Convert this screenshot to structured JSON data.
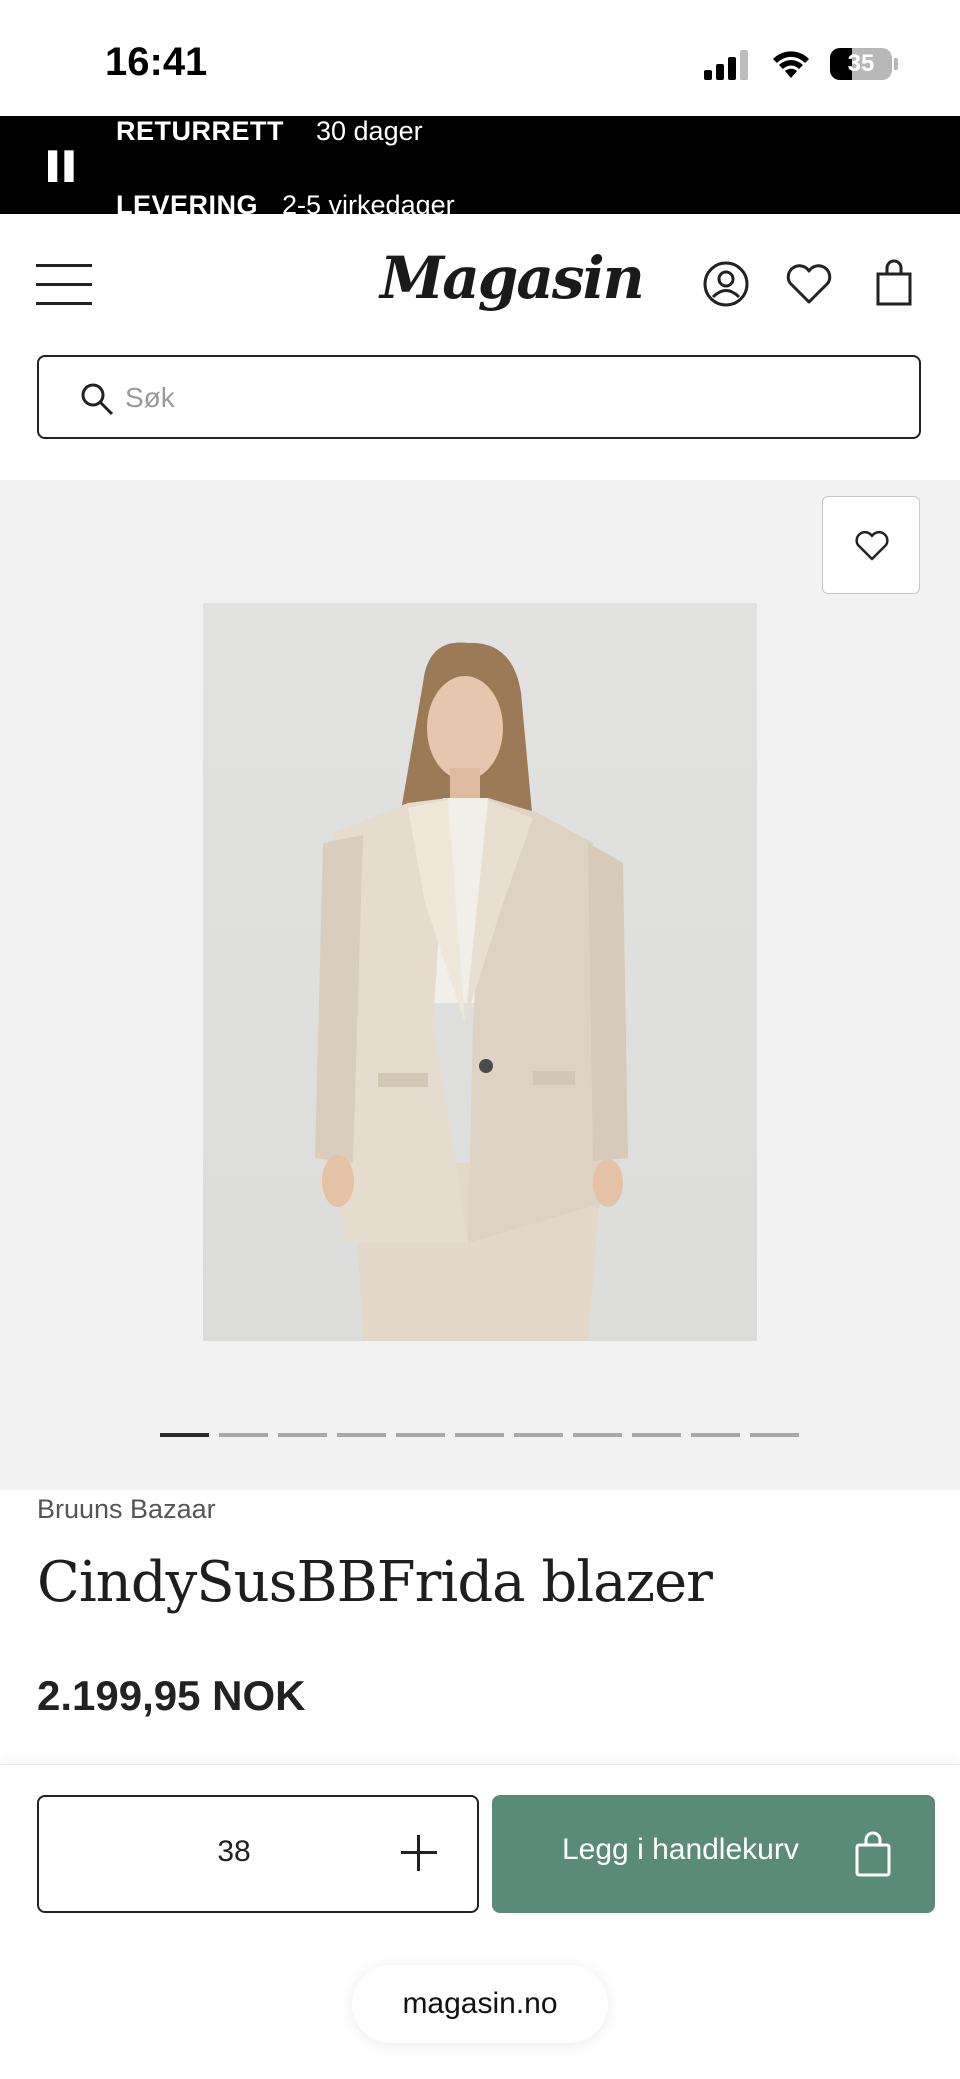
{
  "status_bar": {
    "time": "16:41",
    "battery_level": "35",
    "battery_fraction": 0.35
  },
  "promo": {
    "return_label": "RETURRETT",
    "return_value": "30 dager",
    "delivery_label": "LEVERING",
    "delivery_value": "2-5 virkedager"
  },
  "header": {
    "logo": "Magasin"
  },
  "search": {
    "placeholder": "Søk"
  },
  "gallery": {
    "image_count": 11,
    "active_index": 0
  },
  "product": {
    "brand": "Bruuns Bazaar",
    "name": "CindySusBBFrida blazer",
    "price": "2.199,95 NOK"
  },
  "purchase": {
    "size": "38",
    "add_to_cart_label": "Legg i handlekurv",
    "accent_color": "#5a8a78"
  },
  "browser": {
    "url": "magasin.no"
  }
}
